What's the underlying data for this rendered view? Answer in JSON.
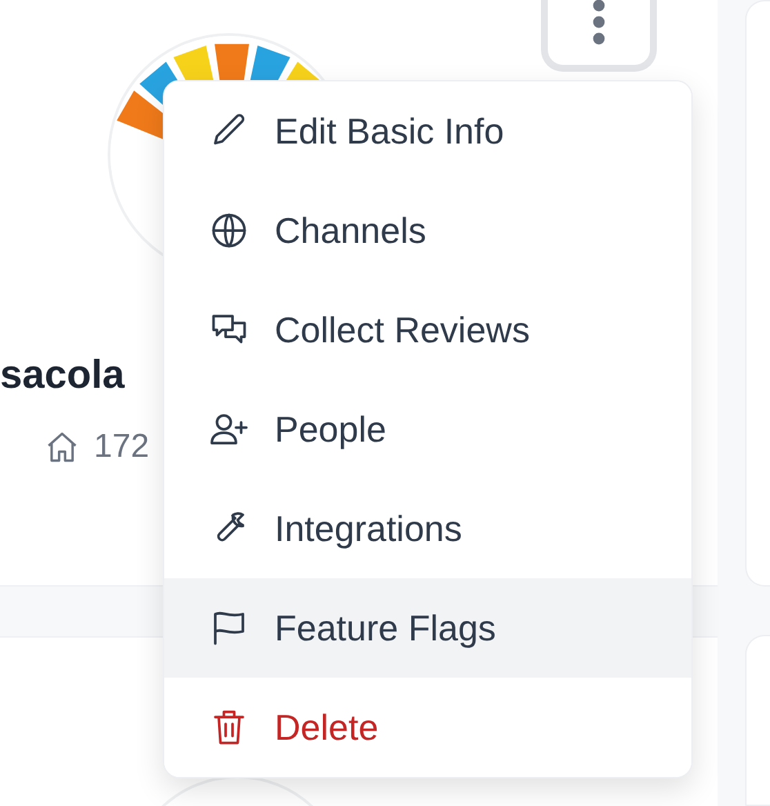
{
  "profile": {
    "name": "sacola",
    "stat": "172"
  },
  "menu": {
    "items": [
      {
        "label": "Edit Basic Info",
        "kind": "normal",
        "selected": false
      },
      {
        "label": "Channels",
        "kind": "normal",
        "selected": false
      },
      {
        "label": "Collect Reviews",
        "kind": "normal",
        "selected": false
      },
      {
        "label": "People",
        "kind": "normal",
        "selected": false
      },
      {
        "label": "Integrations",
        "kind": "normal",
        "selected": false
      },
      {
        "label": "Feature Flags",
        "kind": "normal",
        "selected": true
      },
      {
        "label": "Delete",
        "kind": "danger",
        "selected": false
      }
    ]
  }
}
